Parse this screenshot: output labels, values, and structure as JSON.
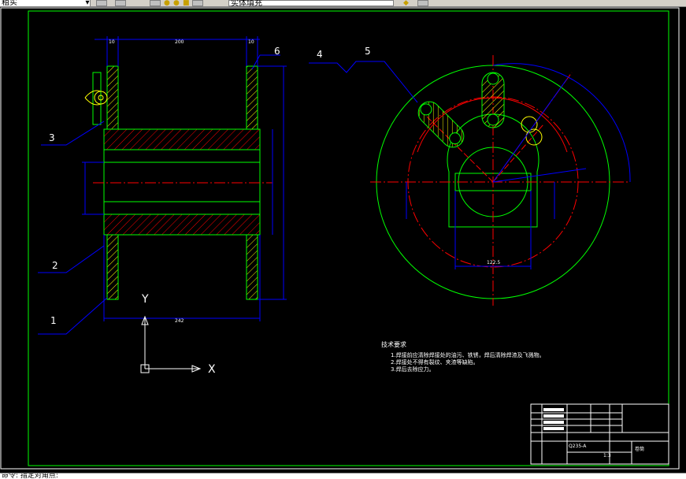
{
  "toolbar": {
    "layer_value": "粗实",
    "line_combo": "实体填充",
    "dropdown_glyph": "▾"
  },
  "drawing": {
    "part_labels": [
      "1",
      "2",
      "3",
      "4",
      "5",
      "6"
    ],
    "dims": {
      "top_left": "10",
      "top_mid": "200",
      "top_right": "10",
      "bottom": "242",
      "bore": "122.5"
    },
    "ucs": {
      "x": "X",
      "y": "Y"
    },
    "tech_req": {
      "title": "技术要求",
      "items": [
        "1.焊接前应清除焊接处的油污、铁锈，焊后清除焊渣及飞溅物。",
        "2.焊接处不得有裂纹、夹渣等缺陷。",
        "3.焊后去除应力。"
      ]
    },
    "title_block": {
      "material": "Q235-A",
      "name": "卷筒",
      "scale": "1:3"
    }
  },
  "command_line": "命令: 指定对角点:",
  "colors": {
    "green": "#00ff00",
    "red": "#ff0000",
    "blue": "#0000ff",
    "yellow": "#ffff00",
    "white": "#ffffff"
  }
}
